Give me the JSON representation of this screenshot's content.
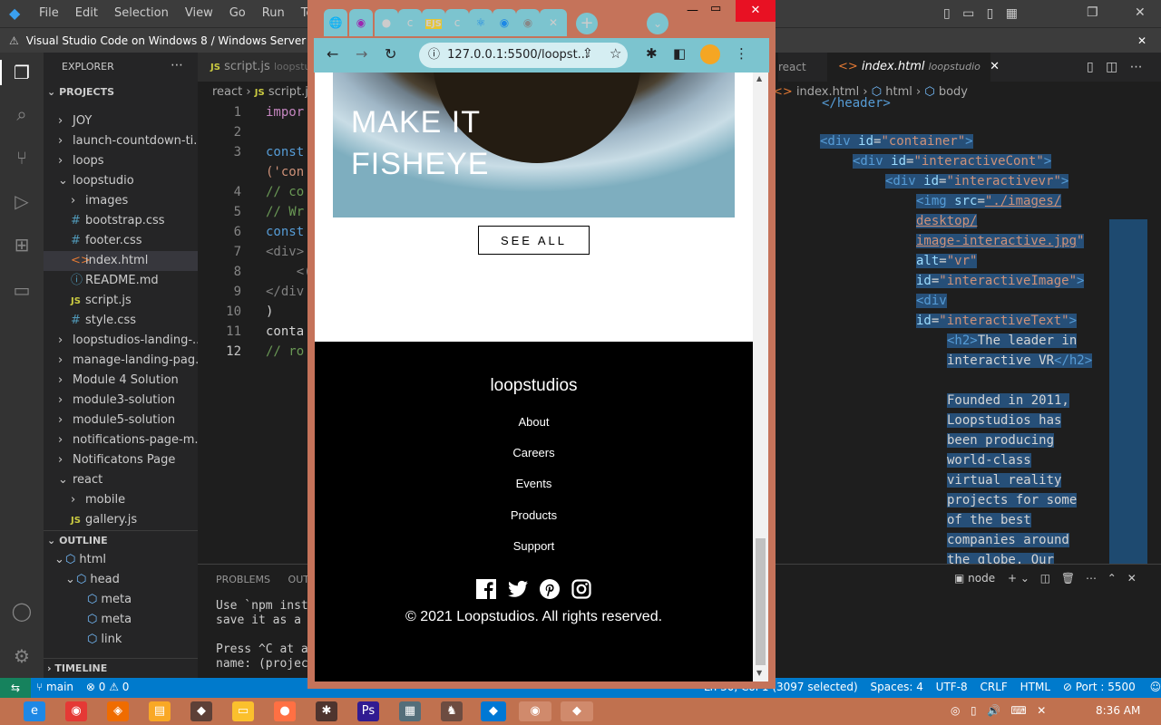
{
  "vscode": {
    "menu": [
      "File",
      "Edit",
      "Selection",
      "View",
      "Go",
      "Run",
      "Termina"
    ],
    "notice": "Visual Studio Code on Windows 8 / Windows Server 2012",
    "explorer_title": "EXPLORER",
    "projects_label": "PROJECTS",
    "tree": [
      {
        "label": "JOY",
        "indent": 1,
        "kind": "folder"
      },
      {
        "label": "launch-countdown-ti...",
        "indent": 1,
        "kind": "folder"
      },
      {
        "label": "loops",
        "indent": 1,
        "kind": "folder"
      },
      {
        "label": "loopstudio",
        "indent": 1,
        "kind": "folder-open"
      },
      {
        "label": "images",
        "indent": 2,
        "kind": "folder"
      },
      {
        "label": "bootstrap.css",
        "indent": 2,
        "kind": "css"
      },
      {
        "label": "footer.css",
        "indent": 2,
        "kind": "css"
      },
      {
        "label": "index.html",
        "indent": 2,
        "kind": "html"
      },
      {
        "label": "README.md",
        "indent": 2,
        "kind": "info"
      },
      {
        "label": "script.js",
        "indent": 2,
        "kind": "js"
      },
      {
        "label": "style.css",
        "indent": 2,
        "kind": "css"
      },
      {
        "label": "loopstudios-landing-...",
        "indent": 1,
        "kind": "folder"
      },
      {
        "label": "manage-landing-pag...",
        "indent": 1,
        "kind": "folder"
      },
      {
        "label": "Module 4 Solution",
        "indent": 1,
        "kind": "folder"
      },
      {
        "label": "module3-solution",
        "indent": 1,
        "kind": "folder"
      },
      {
        "label": "module5-solution",
        "indent": 1,
        "kind": "folder"
      },
      {
        "label": "notifications-page-m...",
        "indent": 1,
        "kind": "folder"
      },
      {
        "label": "Notificatons Page",
        "indent": 1,
        "kind": "folder"
      },
      {
        "label": "react",
        "indent": 1,
        "kind": "folder-open"
      },
      {
        "label": "mobile",
        "indent": 2,
        "kind": "folder"
      },
      {
        "label": "gallery.js",
        "indent": 2,
        "kind": "js"
      }
    ],
    "outline_title": "OUTLINE",
    "outline": [
      {
        "label": "html",
        "indent": 1
      },
      {
        "label": "head",
        "indent": 2
      },
      {
        "label": "meta",
        "indent": 3
      },
      {
        "label": "meta",
        "indent": 3
      },
      {
        "label": "link",
        "indent": 3
      }
    ],
    "timeline_title": "TIMELINE",
    "left_tab": "script.js",
    "left_tab_hint": "loopstu",
    "left_breadcrumb": [
      "react",
      "script.js"
    ],
    "left_code": [
      {
        "n": "1",
        "text": "impor"
      },
      {
        "n": "2",
        "text": ""
      },
      {
        "n": "3",
        "text": "const"
      },
      {
        "n": "",
        "text": "('con"
      },
      {
        "n": "4",
        "text": "// co"
      },
      {
        "n": "5",
        "text": "// Wr"
      },
      {
        "n": "6",
        "text": "const"
      },
      {
        "n": "7",
        "text": "<div>"
      },
      {
        "n": "8",
        "text": "    <("
      },
      {
        "n": "9",
        "text": "</div"
      },
      {
        "n": "10",
        "text": ")"
      },
      {
        "n": "11",
        "text": "conta"
      },
      {
        "n": "12",
        "text": "// ro"
      }
    ],
    "right_tab_prev": "react",
    "right_tab": "index.html",
    "right_tab_hint": "loopstudio",
    "right_breadcrumb": [
      "index.html",
      "html",
      "body"
    ],
    "right_code_top": "</header>",
    "panel_tabs": [
      "PROBLEMS",
      "OUTI"
    ],
    "panel_terminal_label": "node",
    "terminal_lines": [
      "Use `npm insta",
      "save it as a d",
      "",
      "Press ^C at an",
      "name: (project"
    ],
    "status": {
      "branch": "main",
      "errors": "0",
      "warnings": "0",
      "cursor": "Ln 30, Col 1 (3097 selected)",
      "spaces": "Spaces: 4",
      "encoding": "UTF-8",
      "eol": "CRLF",
      "language": "HTML",
      "port": "Port : 5500"
    }
  },
  "browser": {
    "url": "127.0.0.1:5500/loopst...",
    "hero_title": "MAKE IT\nFISHEYE",
    "see_all": "SEE ALL",
    "footer_brand": "loopstudios",
    "footer_links": [
      "About",
      "Careers",
      "Events",
      "Products",
      "Support"
    ],
    "social_icons": [
      "facebook-icon",
      "twitter-icon",
      "pinterest-icon",
      "instagram-icon"
    ],
    "copyright": "© 2021 Loopstudios. All rights reserved."
  },
  "taskbar": {
    "time": "8:36 AM"
  },
  "colors": {
    "taskbar": "#c0714f",
    "browser_frame": "#c5735a",
    "browser_toolbar": "#7cc4cf",
    "status_bar": "#007acc"
  }
}
